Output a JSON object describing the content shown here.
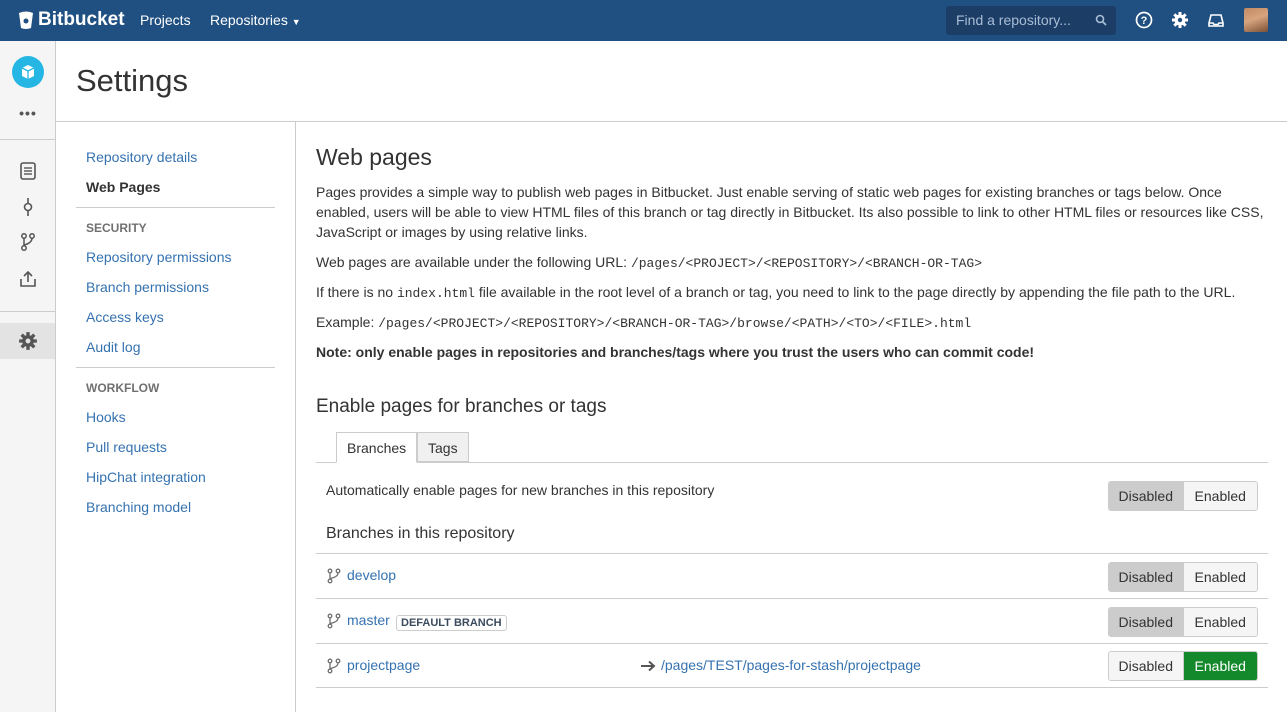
{
  "topbar": {
    "brand": "Bitbucket",
    "nav": [
      "Projects",
      "Repositories"
    ],
    "search_placeholder": "Find a repository...",
    "icons": [
      "help-icon",
      "gear-icon",
      "notifications-icon"
    ]
  },
  "sidebar": {
    "icons": [
      "project-avatar-icon",
      "more-icon",
      "source-icon",
      "commits-icon",
      "branches-icon",
      "pull-requests-icon",
      "settings-icon"
    ]
  },
  "page_title": "Settings",
  "left_nav": {
    "items_top": [
      "Repository details",
      "Web Pages"
    ],
    "security_heading": "SECURITY",
    "security_items": [
      "Repository permissions",
      "Branch permissions",
      "Access keys",
      "Audit log"
    ],
    "workflow_heading": "WORKFLOW",
    "workflow_items": [
      "Hooks",
      "Pull requests",
      "HipChat integration",
      "Branching model"
    ]
  },
  "main": {
    "title": "Web pages",
    "intro": "Pages provides a simple way to publish web pages in Bitbucket. Just enable serving of static web pages for existing branches or tags below. Once enabled, users will be able to view HTML files of this branch or tag directly in Bitbucket. Its also possible to link to other HTML files or resources like CSS, JavaScript or images by using relative links.",
    "url_text": "Web pages are available under the following URL:",
    "url_pattern": "/pages/<PROJECT>/<REPOSITORY>/<BRANCH-OR-TAG>",
    "index_before": "If there is no",
    "index_file": "index.html",
    "index_after": "file available in the root level of a branch or tag, you need to link to the page directly by appending the file path to the URL.",
    "example_label": "Example:",
    "example_pattern": "/pages/<PROJECT>/<REPOSITORY>/<BRANCH-OR-TAG>/browse/<PATH>/<TO>/<FILE>.html",
    "note": "Note: only enable pages in repositories and branches/tags where you trust the users who can commit code!",
    "section_title": "Enable pages for branches or tags",
    "tabs": [
      "Branches",
      "Tags"
    ],
    "auto_label": "Automatically enable pages for new branches in this repository",
    "branches_heading": "Branches in this repository",
    "toggle_disabled": "Disabled",
    "toggle_enabled": "Enabled",
    "branches": [
      {
        "name": "develop",
        "badge": "",
        "link": "",
        "state": "Disabled"
      },
      {
        "name": "master",
        "badge": "DEFAULT BRANCH",
        "link": "",
        "state": "Disabled"
      },
      {
        "name": "projectpage",
        "badge": "",
        "link": "/pages/TEST/pages-for-stash/projectpage",
        "state": "Enabled"
      }
    ],
    "colors": {
      "enabled": "#14892c",
      "link": "#3572b0",
      "brand": "#205081"
    }
  }
}
